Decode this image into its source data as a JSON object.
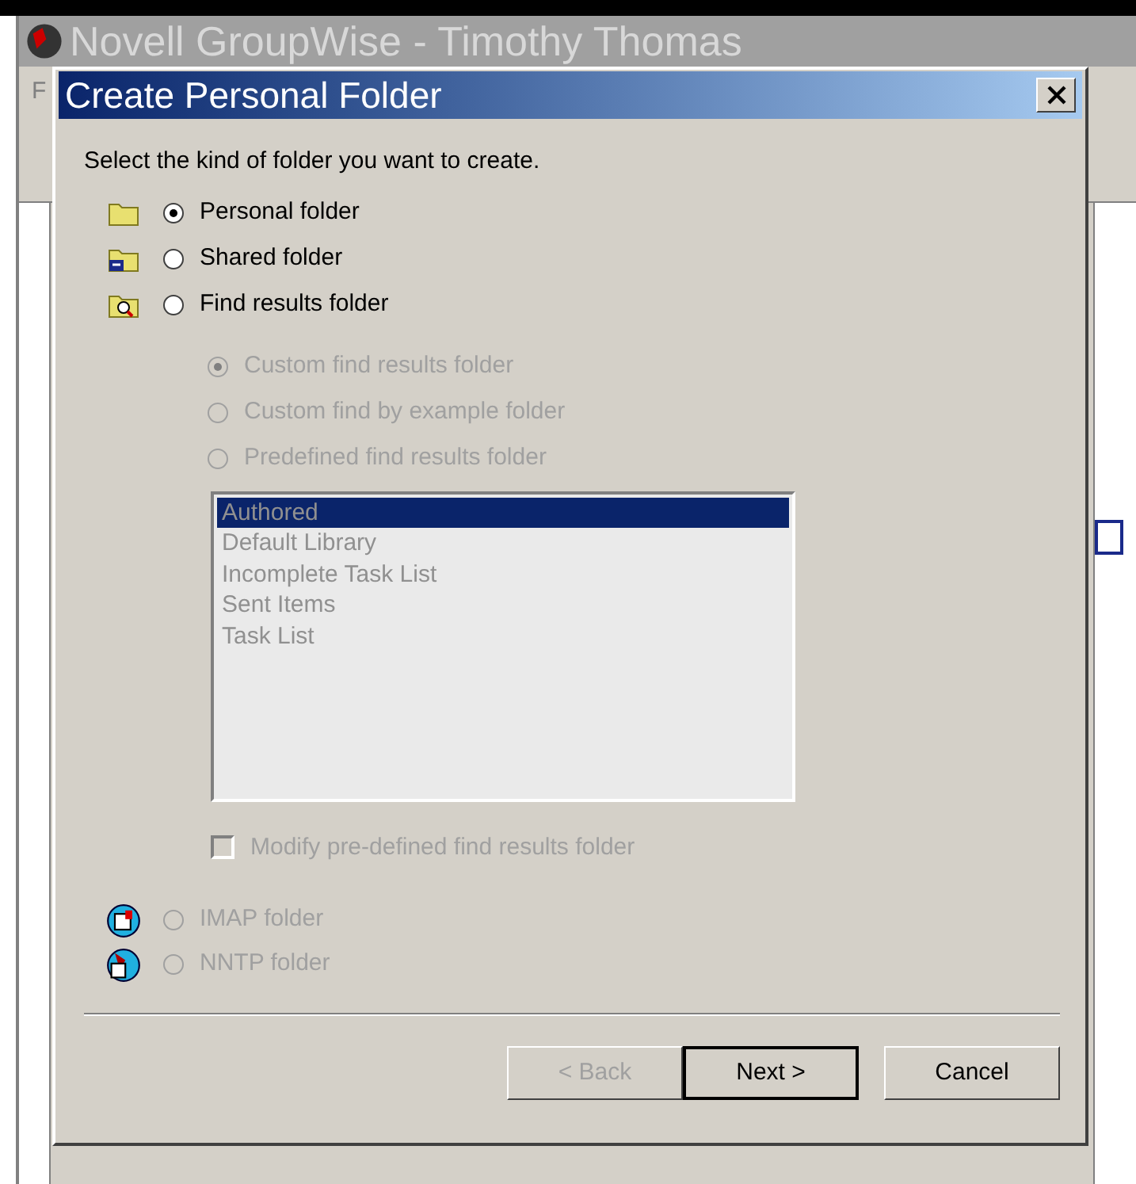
{
  "background_window": {
    "title": "Novell GroupWise - Timothy Thomas",
    "menu": [
      "F"
    ]
  },
  "dialog": {
    "title": "Create Personal Folder",
    "instruction": "Select the kind of folder you want to create.",
    "folder_types": [
      {
        "label": "Personal folder",
        "kind": "folder",
        "selected": true,
        "disabled": false
      },
      {
        "label": "Shared folder",
        "kind": "shared",
        "selected": false,
        "disabled": false
      },
      {
        "label": "Find results folder",
        "kind": "find",
        "selected": false,
        "disabled": false
      }
    ],
    "find_options": [
      {
        "label": "Custom find results folder",
        "selected": true,
        "disabled": true
      },
      {
        "label": "Custom find by example folder",
        "selected": false,
        "disabled": true
      },
      {
        "label": "Predefined find results folder",
        "selected": false,
        "disabled": true
      }
    ],
    "predefined_list": {
      "disabled": true,
      "items": [
        {
          "label": "Authored",
          "selected": true
        },
        {
          "label": "Default Library",
          "selected": false
        },
        {
          "label": "Incomplete Task List",
          "selected": false
        },
        {
          "label": "Sent Items",
          "selected": false
        },
        {
          "label": "Task List",
          "selected": false
        }
      ]
    },
    "modify_checkbox": {
      "label": "Modify pre-defined find results folder",
      "checked": false,
      "disabled": true
    },
    "other_types": [
      {
        "label": "IMAP folder",
        "kind": "imap",
        "selected": false,
        "disabled": true
      },
      {
        "label": "NNTP folder",
        "kind": "nntp",
        "selected": false,
        "disabled": true
      }
    ],
    "buttons": [
      {
        "label": "< Back",
        "disabled": true,
        "default": false
      },
      {
        "label": "Next >",
        "disabled": false,
        "default": true
      },
      {
        "label": "Cancel",
        "disabled": false,
        "default": false
      }
    ]
  }
}
